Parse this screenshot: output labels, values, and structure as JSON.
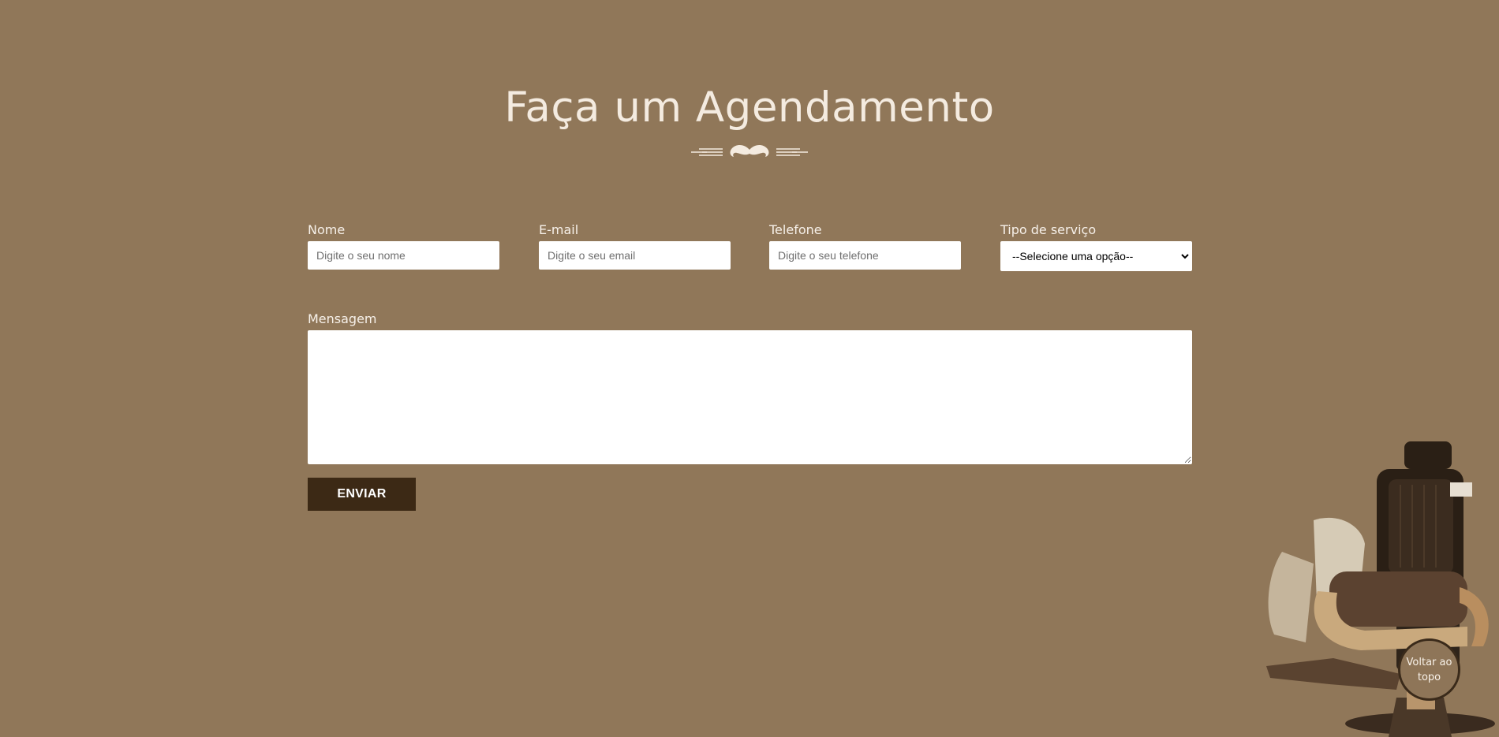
{
  "section": {
    "title": "Faça um Agendamento"
  },
  "form": {
    "name": {
      "label": "Nome",
      "placeholder": "Digite o seu nome"
    },
    "email": {
      "label": "E-mail",
      "placeholder": "Digite o seu email"
    },
    "phone": {
      "label": "Telefone",
      "placeholder": "Digite o seu telefone"
    },
    "service": {
      "label": "Tipo de serviço",
      "selected": "--Selecione uma opção--"
    },
    "message": {
      "label": "Mensagem",
      "value": ""
    },
    "submit_label": "ENVIAR"
  },
  "back_to_top_label": "Voltar ao topo",
  "icons": {
    "divider": "mustache-icon",
    "decoration": "barber-chair-icon"
  },
  "colors": {
    "background": "#907759",
    "title": "#f4ebe0",
    "button": "#3c2915",
    "button_text": "#ffffff"
  }
}
